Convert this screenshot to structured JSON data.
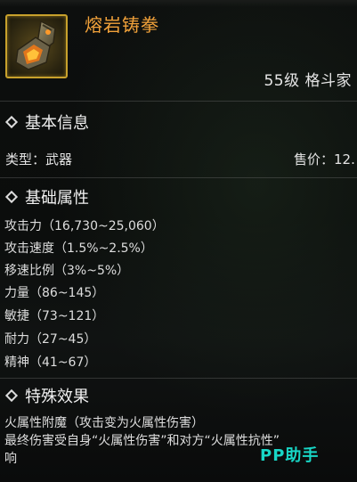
{
  "item": {
    "name": "熔岩铸拳",
    "icon": "lava-gauntlet-icon",
    "level_class": "55级 格斗家"
  },
  "sections": {
    "basic_info": {
      "title": "基本信息",
      "type_text": "类型：武器",
      "price_text": "售价：12."
    },
    "base_attributes": {
      "title": "基础属性",
      "lines": [
        "攻击力（16,730~25,060）",
        "攻击速度（1.5%~2.5%）",
        "移速比例（3%~5%）",
        "力量（86~145）",
        "敏捷（73~121）",
        "耐力（27~45）",
        "精神（41~67）"
      ]
    },
    "special_effects": {
      "title": "特殊效果",
      "lines": [
        "火属性附魔（攻击变为火属性伤害）",
        "最终伤害受自身“火属性伤害”和对方“火属性抗性”",
        "响"
      ]
    }
  },
  "watermark": "PP助手",
  "colors": {
    "item_name": "#f2a23a",
    "icon_border": "#c8a12c",
    "watermark": "#18d6c6",
    "text": "#e2e2e2"
  }
}
